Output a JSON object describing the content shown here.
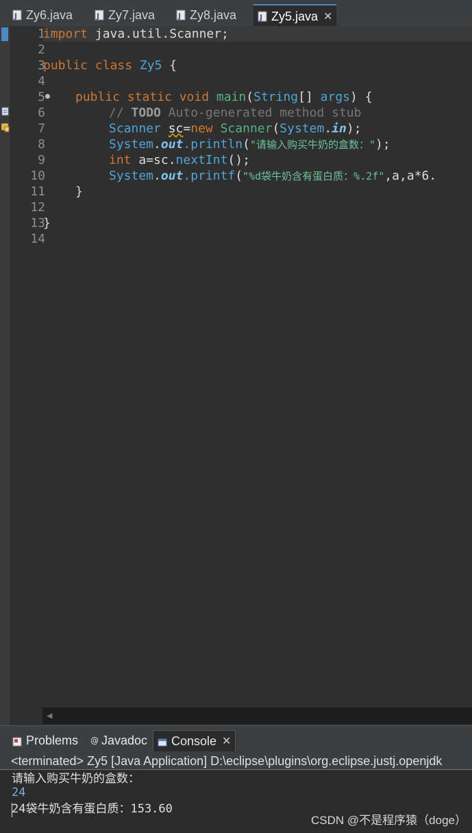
{
  "editor_tabs": [
    {
      "label": "Zy6.java",
      "icon": "java-file-icon",
      "active": false
    },
    {
      "label": "Zy7.java",
      "icon": "java-file-icon",
      "active": false
    },
    {
      "label": "Zy8.java",
      "icon": "java-file-icon",
      "active": false
    },
    {
      "label": "Zy5.java",
      "icon": "java-file-icon",
      "active": true,
      "close": "✕"
    }
  ],
  "line_numbers": [
    "1",
    "2",
    "3",
    "4",
    "5",
    "6",
    "7",
    "8",
    "9",
    "10",
    "11",
    "12",
    "13",
    "14"
  ],
  "code": {
    "l1_kw": "import",
    "l1_rest": " java.util.Scanner;",
    "l3_kw": "public class",
    "l3_cls": "Zy5",
    "l3_rest": " {",
    "l5_kw": "public static void",
    "l5_fn": "main",
    "l5_p1": "(",
    "l5_typ": "String",
    "l5_p2": "[] ",
    "l5_arg": "args",
    "l5_p3": ") {",
    "l6_c1": "// ",
    "l6_todo": "TODO",
    "l6_c2": " Auto-generated method stub",
    "l7_typ": "Scanner",
    "l7_var": "sc",
    "l7_eq": "=",
    "l7_new": "new",
    "l7_ctor": "Scanner",
    "l7_p1": "(",
    "l7_sys": "System",
    "l7_dot": ".",
    "l7_in": "in",
    "l7_p2": ");",
    "l8_sys": "System",
    "l8_dot": ".",
    "l8_out": "out",
    "l8_m": ".println",
    "l8_p1": "(",
    "l8_str": "\"请输入购买牛奶的盒数：\"",
    "l8_p2": ");",
    "l9_kw": "int",
    "l9_rest": " a=sc.",
    "l9_m": "nextInt",
    "l9_p": "();",
    "l10_sys": "System",
    "l10_dot": ".",
    "l10_out": "out",
    "l10_m": ".printf",
    "l10_p1": "(",
    "l10_str": "\"%d袋牛奶含有蛋白质：%.2f\"",
    "l10_rest": ",a,a*6.",
    "l11": "}",
    "l13": "}"
  },
  "panel_tabs": [
    {
      "label": "Problems",
      "icon": "problems-icon",
      "active": false
    },
    {
      "label": "Javadoc",
      "icon": "javadoc-icon",
      "active": false
    },
    {
      "label": "Console",
      "icon": "console-icon",
      "active": true,
      "close": "✕"
    }
  ],
  "console": {
    "header": "<terminated> Zy5 [Java Application] D:\\eclipse\\plugins\\org.eclipse.justj.openjdk",
    "lines": [
      "请输入购买牛奶的盒数：",
      "24",
      "24袋牛奶含有蛋白质：153.60"
    ]
  },
  "watermark": "CSDN @不是程序猿（doge）",
  "colors": {
    "keyword": "#cc7832",
    "type": "#4ea5d6",
    "string": "#6bc29a",
    "console_input": "#7fa9e0"
  }
}
